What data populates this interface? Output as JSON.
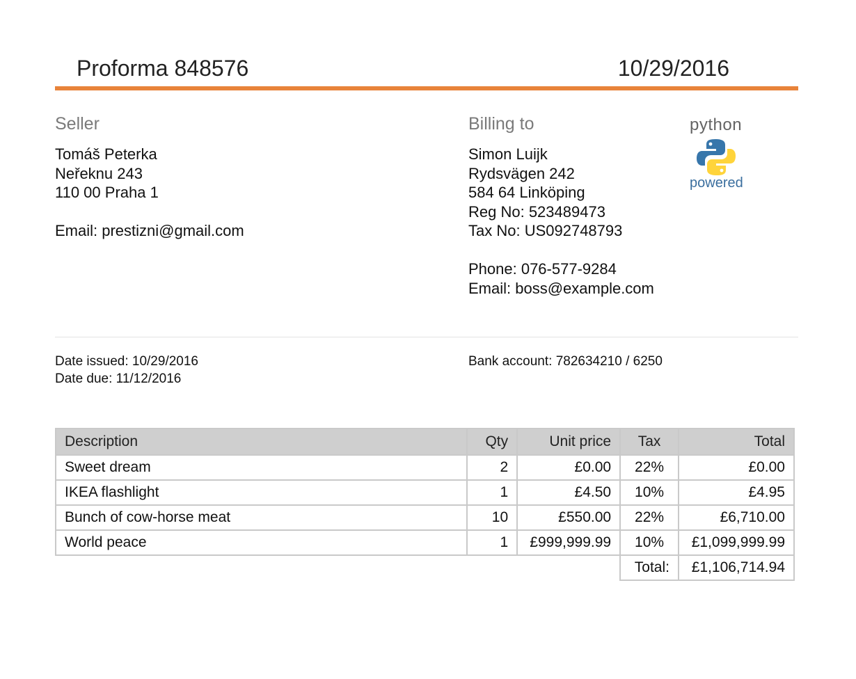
{
  "header": {
    "title": "Proforma 848576",
    "date": "10/29/2016"
  },
  "seller": {
    "heading": "Seller",
    "name": "Tomáš Peterka",
    "street": "Neřeknu 243",
    "city": "110 00 Praha 1",
    "email": "Email: prestizni@gmail.com"
  },
  "billing": {
    "heading": "Billing to",
    "name": "Simon Luijk",
    "street": "Rydsvägen 242",
    "city": "584 64 Linköping",
    "reg": "Reg No: 523489473",
    "tax": "Tax No: US092748793",
    "phone": "Phone: 076-577-9284",
    "email": "Email: boss@example.com"
  },
  "logo": {
    "top_text": "python",
    "bottom_text": "powered",
    "icon": "python-logo-icon",
    "colors": {
      "blue": "#3776ab",
      "yellow": "#ffd43b"
    }
  },
  "dates": {
    "issued": "Date issued: 10/29/2016",
    "due": "Date due: 11/12/2016"
  },
  "bank": {
    "account": "Bank account: 782634210 / 6250"
  },
  "table": {
    "headers": {
      "description": "Description",
      "qty": "Qty",
      "unit_price": "Unit price",
      "tax": "Tax",
      "total": "Total"
    },
    "rows": [
      {
        "description": "Sweet dream",
        "qty": "2",
        "unit_price": "£0.00",
        "tax": "22%",
        "total": "£0.00"
      },
      {
        "description": "IKEA flashlight",
        "qty": "1",
        "unit_price": "£4.50",
        "tax": "10%",
        "total": "£4.95"
      },
      {
        "description": "Bunch of cow-horse meat",
        "qty": "10",
        "unit_price": "£550.00",
        "tax": "22%",
        "total": "£6,710.00"
      },
      {
        "description": "World peace",
        "qty": "1",
        "unit_price": "£999,999.99",
        "tax": "10%",
        "total": "£1,099,999.99"
      }
    ],
    "grand_total_label": "Total:",
    "grand_total": "£1,106,714.94"
  },
  "colors": {
    "accent": "#e8833a",
    "header_bg": "#cfcfcf",
    "heading_gray": "#7a7a7a"
  }
}
